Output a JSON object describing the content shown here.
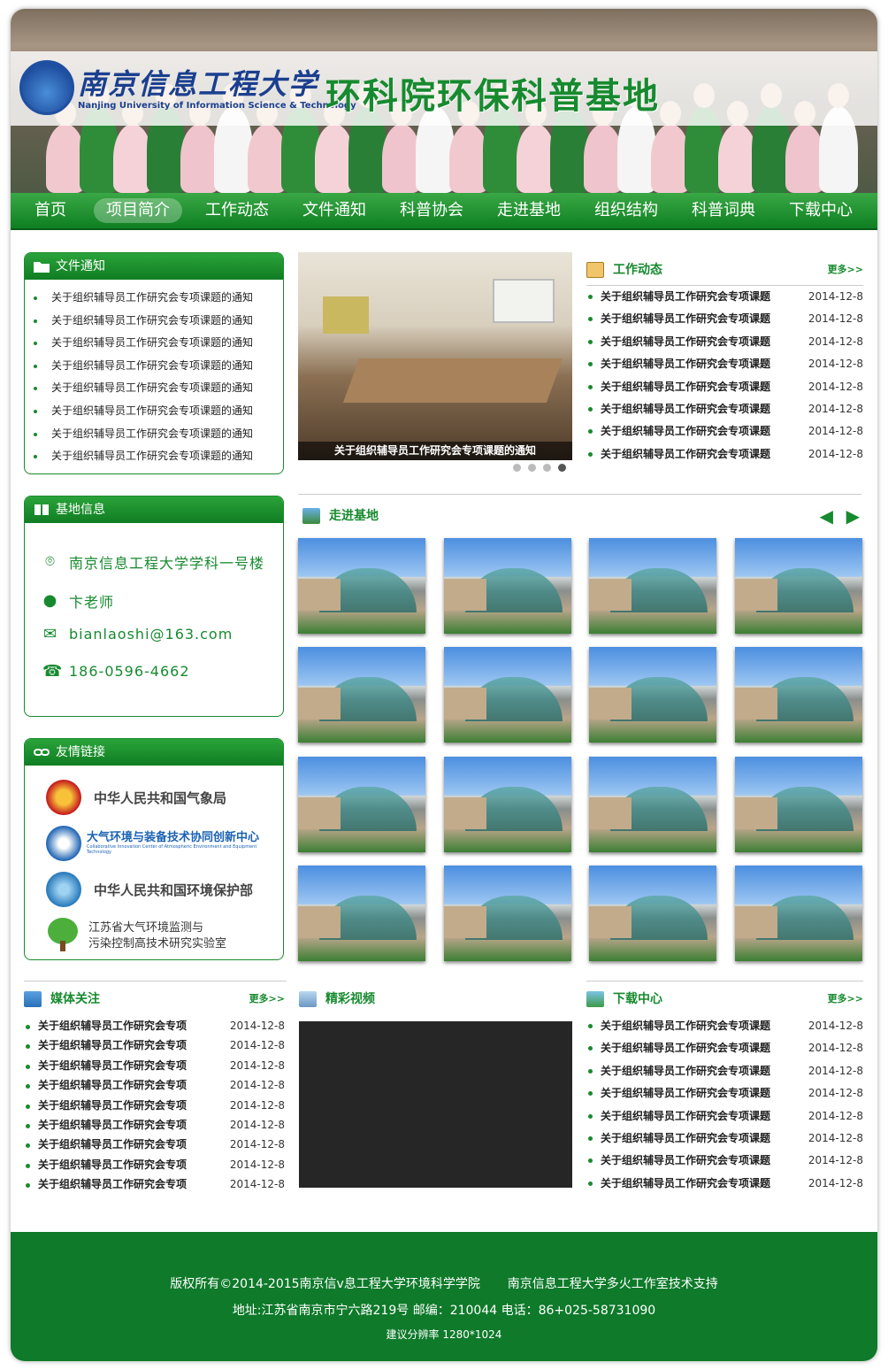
{
  "header": {
    "logo_cn": "南京信息工程大学",
    "logo_en": "Nanjing University of Information Science & Technology",
    "site_title": "环科院环保科普基地"
  },
  "nav": {
    "items": [
      "首页",
      "项目简介",
      "工作动态",
      "文件通知",
      "科普协会",
      "走进基地",
      "组织结构",
      "科普词典",
      "下载中心"
    ]
  },
  "notice_panel": {
    "title": "文件通知",
    "items": [
      "关于组织辅导员工作研究会专项课题的通知",
      "关于组织辅导员工作研究会专项课题的通知",
      "关于组织辅导员工作研究会专项课题的通知",
      "关于组织辅导员工作研究会专项课题的通知",
      "关于组织辅导员工作研究会专项课题的通知",
      "关于组织辅导员工作研究会专项课题的通知",
      "关于组织辅导员工作研究会专项课题的通知",
      "关于组织辅导员工作研究会专项课题的通知"
    ]
  },
  "slider": {
    "caption": "关于组织辅导员工作研究会专项课题的通知",
    "active_dot": 4,
    "dot_count": 4
  },
  "work_news": {
    "title": "工作动态",
    "more": "更多>>",
    "items": [
      {
        "text": "关于组织辅导员工作研究会专项课题",
        "date": "2014-12-8"
      },
      {
        "text": "关于组织辅导员工作研究会专项课题",
        "date": "2014-12-8"
      },
      {
        "text": "关于组织辅导员工作研究会专项课题",
        "date": "2014-12-8"
      },
      {
        "text": "关于组织辅导员工作研究会专项课题",
        "date": "2014-12-8"
      },
      {
        "text": "关于组织辅导员工作研究会专项课题",
        "date": "2014-12-8"
      },
      {
        "text": "关于组织辅导员工作研究会专项课题",
        "date": "2014-12-8"
      },
      {
        "text": "关于组织辅导员工作研究会专项课题",
        "date": "2014-12-8"
      },
      {
        "text": "关于组织辅导员工作研究会专项课题",
        "date": "2014-12-8"
      }
    ]
  },
  "base_info": {
    "title": "基地信息",
    "address": "南京信息工程大学学科一号楼",
    "contact": "卞老师",
    "email": "bianlaoshi@163.com",
    "phone": "186-0596-4662"
  },
  "enter_base": {
    "title": "走进基地"
  },
  "links": {
    "title": "友情链接",
    "items": [
      {
        "name": "中华人民共和国气象局"
      },
      {
        "name": "大气环境与装备技术协同创新中心",
        "sub": "Collaborative Innovation Center of Atmospheric Environment and Equipment Technology"
      },
      {
        "name": "中华人民共和国环境保护部"
      },
      {
        "name": "江苏省大气环境监测与",
        "name2": "污染控制高技术研究实验室"
      }
    ]
  },
  "media": {
    "title": "媒体关注",
    "more": "更多>>",
    "items": [
      {
        "text": "关于组织辅导员工作研究会专项",
        "date": "2014-12-8"
      },
      {
        "text": "关于组织辅导员工作研究会专项",
        "date": "2014-12-8"
      },
      {
        "text": "关于组织辅导员工作研究会专项",
        "date": "2014-12-8"
      },
      {
        "text": "关于组织辅导员工作研究会专项",
        "date": "2014-12-8"
      },
      {
        "text": "关于组织辅导员工作研究会专项",
        "date": "2014-12-8"
      },
      {
        "text": "关于组织辅导员工作研究会专项",
        "date": "2014-12-8"
      },
      {
        "text": "关于组织辅导员工作研究会专项",
        "date": "2014-12-8"
      },
      {
        "text": "关于组织辅导员工作研究会专项",
        "date": "2014-12-8"
      },
      {
        "text": "关于组织辅导员工作研究会专项",
        "date": "2014-12-8"
      }
    ]
  },
  "video": {
    "title": "精彩视频"
  },
  "downloads": {
    "title": "下载中心",
    "more": "更多>>",
    "items": [
      {
        "text": "关于组织辅导员工作研究会专项课题",
        "date": "2014-12-8"
      },
      {
        "text": "关于组织辅导员工作研究会专项课题",
        "date": "2014-12-8"
      },
      {
        "text": "关于组织辅导员工作研究会专项课题",
        "date": "2014-12-8"
      },
      {
        "text": "关于组织辅导员工作研究会专项课题",
        "date": "2014-12-8"
      },
      {
        "text": "关于组织辅导员工作研究会专项课题",
        "date": "2014-12-8"
      },
      {
        "text": "关于组织辅导员工作研究会专项课题",
        "date": "2014-12-8"
      },
      {
        "text": "关于组织辅导员工作研究会专项课题",
        "date": "2014-12-8"
      },
      {
        "text": "关于组织辅导员工作研究会专项课题",
        "date": "2014-12-8"
      }
    ]
  },
  "footer": {
    "line1a": "版权所有©2014-2015南京信v息工程大学环境科学学院",
    "line1b": "南京信息工程大学多火工作室技术支持",
    "line2": "地址:江苏省南京市宁六路219号  邮编：210044  电话：86+025-58731090",
    "line3": "建议分辨率 1280*1024"
  },
  "colors": {
    "brand_green": "#178a2f",
    "footer_green": "#0e7a2a"
  }
}
